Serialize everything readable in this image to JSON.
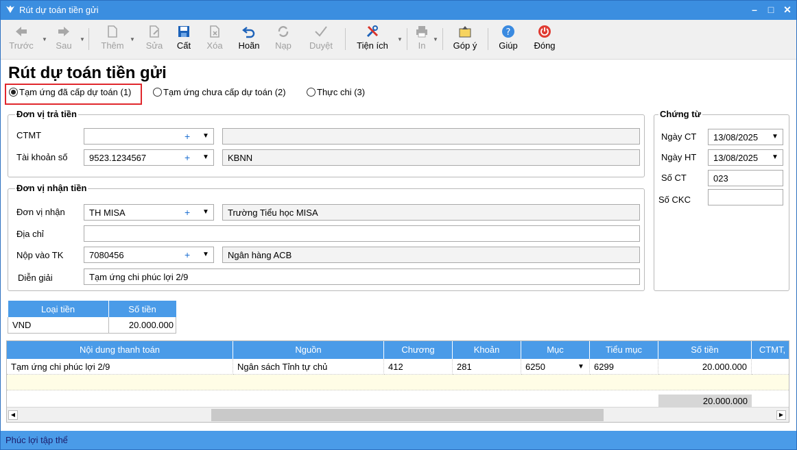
{
  "window": {
    "title": "Rút dự toán tiền gửi",
    "minimize": "–",
    "maximize": "□",
    "close": "✕"
  },
  "toolbar": {
    "back": "Trước",
    "next": "Sau",
    "add": "Thêm",
    "edit": "Sửa",
    "save": "Cất",
    "delete": "Xóa",
    "undo": "Hoãn",
    "load": "Nạp",
    "approve": "Duyệt",
    "utilities": "Tiện ích",
    "print": "In",
    "feedback": "Góp ý",
    "help": "Giúp",
    "close": "Đóng"
  },
  "page_title": "Rút dự toán tiền gửi",
  "radios": [
    {
      "label": "Tạm ứng đã cấp dự toán (1)",
      "checked": true
    },
    {
      "label": "Tạm ứng chưa cấp dự toán (2)",
      "checked": false
    },
    {
      "label": "Thực chi (3)",
      "checked": false
    }
  ],
  "payer": {
    "legend": "Đơn vị trả tiền",
    "ctmt_label": "CTMT",
    "ctmt_value": "",
    "ctmt_name": "",
    "account_label": "Tài khoản số",
    "account_value": "9523.1234567",
    "account_name": "KBNN"
  },
  "payee": {
    "legend": "Đơn vị nhận tiền",
    "unit_label": "Đơn vị nhận",
    "unit_value": "TH MISA",
    "unit_name": "Trường Tiểu học MISA",
    "address_label": "Địa chỉ",
    "address_value": "",
    "deposit_label": "Nộp vào TK",
    "deposit_value": "7080456",
    "deposit_name": "Ngân hàng ACB",
    "desc_label": "Diễn giải",
    "desc_value": "Tạm ứng chi phúc lợi 2/9"
  },
  "voucher": {
    "legend": "Chứng từ",
    "date_ct_label": "Ngày CT",
    "date_ct_value": "13/08/2025",
    "date_ht_label": "Ngày HT",
    "date_ht_value": "13/08/2025",
    "no_ct_label": "Số CT",
    "no_ct_value": "023",
    "no_ckc_label": "Số CKC",
    "no_ckc_value": ""
  },
  "currency_grid": {
    "headers": [
      "Loại tiền",
      "Số tiền"
    ],
    "row": [
      "VND",
      "20.000.000"
    ]
  },
  "main_grid": {
    "headers": [
      "Nội dung thanh toán",
      "Nguồn",
      "Chương",
      "Khoản",
      "Mục",
      "Tiểu mục",
      "Số tiền",
      "CTMT,"
    ],
    "row": [
      "Tạm ứng chi phúc lợi 2/9",
      "Ngân sách Tỉnh tự chủ",
      "412",
      "281",
      "6250",
      "6299",
      "20.000.000",
      ""
    ],
    "total": "20.000.000"
  },
  "status": "Phúc lợi tập thể",
  "colors": {
    "titlebar": "#3b8ee0",
    "grid_header": "#4a9be8",
    "highlight_box": "#e0262b",
    "new_row": "#fffde6"
  }
}
